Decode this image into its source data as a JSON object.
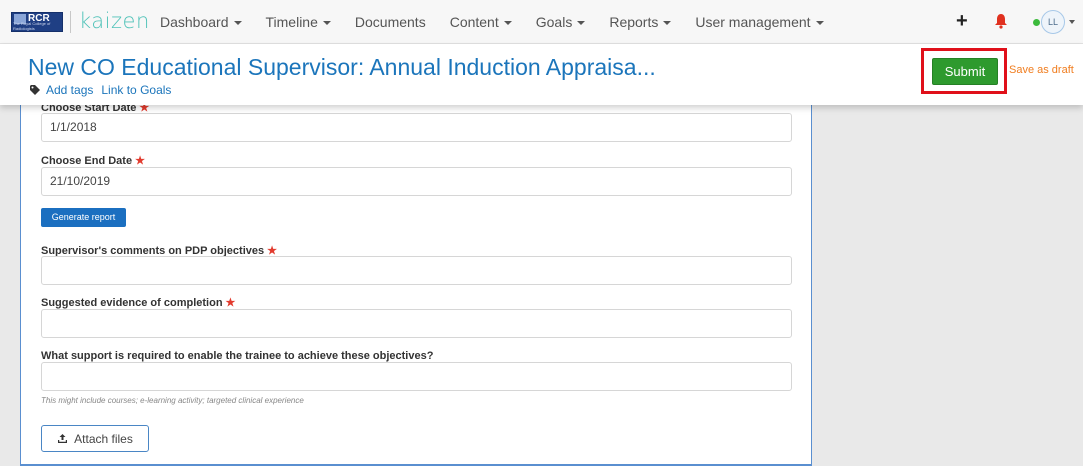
{
  "navbar": {
    "logo_text": "RCR",
    "logo_subtext": "The Royal College of Radiologists",
    "brand": "kaizen",
    "items": [
      {
        "label": "Dashboard",
        "dropdown": true
      },
      {
        "label": "Timeline",
        "dropdown": true
      },
      {
        "label": "Documents",
        "dropdown": false
      },
      {
        "label": "Content",
        "dropdown": true
      },
      {
        "label": "Goals",
        "dropdown": true
      },
      {
        "label": "Reports",
        "dropdown": true
      },
      {
        "label": "User management",
        "dropdown": true
      }
    ],
    "plus_symbol": "+",
    "avatar_initials": "LL"
  },
  "header": {
    "title": "New CO Educational Supervisor: Annual Induction Appraisa...",
    "add_tags": "Add tags",
    "link_goals": "Link to Goals",
    "submit_label": "Submit",
    "draft_label": "Save as draft"
  },
  "form": {
    "start_date": {
      "label": "Choose Start Date",
      "value": "1/1/2018"
    },
    "end_date": {
      "label": "Choose End Date",
      "value": "21/10/2019"
    },
    "generate_label": "Generate report",
    "pdp_comments": {
      "label": "Supervisor's comments on PDP objectives",
      "value": ""
    },
    "evidence": {
      "label": "Suggested evidence of completion",
      "value": ""
    },
    "support": {
      "label": "What support is required to enable the trainee to achieve these objectives?",
      "value": ""
    },
    "support_hint": "This might include courses; e-learning activity; targeted clinical experience",
    "attach_label": "Attach files",
    "required_mark": "★"
  },
  "colors": {
    "accent_blue": "#1b75bb",
    "submit_green": "#2e9a2e",
    "draft_orange": "#f07d1f",
    "highlight_red": "#e0101a",
    "brand_teal": "#52c3b9"
  }
}
